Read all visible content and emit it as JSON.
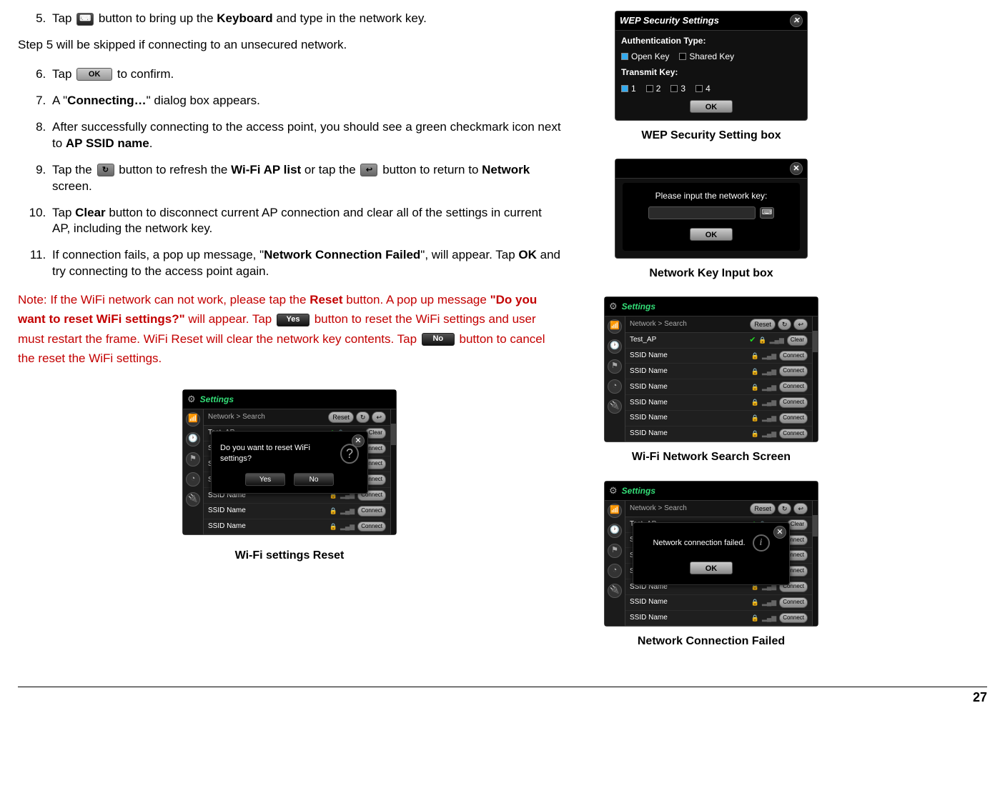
{
  "pageNumber": "27",
  "instructions": {
    "start": 5,
    "step5": {
      "prefix": "Tap ",
      "afterIcon": " button to bring up the ",
      "bold1": "Keyboard",
      "suffix": " and type in the network key."
    },
    "skipLine": "Step 5 will be skipped if connecting to an unsecured network.",
    "step6": {
      "prefix": "Tap ",
      "okLabel": "OK",
      "suffix": " to confirm."
    },
    "step7": {
      "prefix": "A \"",
      "bold": "Connecting…",
      "suffix": "\" dialog box appears."
    },
    "step8": {
      "line1": "After successfully connecting to the access point, you should see a green checkmark icon next to ",
      "bold": "AP SSID name",
      "suffix": "."
    },
    "step9": {
      "prefix": "Tap the ",
      "mid1": " button to refresh the ",
      "bold1": "Wi-Fi AP list",
      "mid2": " or tap the ",
      "mid3": " button to return to ",
      "bold2": "Network",
      "suffix": " screen."
    },
    "step10": {
      "prefix": "Tap ",
      "bold": "Clear",
      "suffix": " button to disconnect current AP connection and clear all of the settings in current AP, including the network key."
    },
    "step11": {
      "p1": "If connection fails, a pop up message, \"",
      "bold1": "Network Connection Failed",
      "p2": "\", will appear.  Tap ",
      "bold2": "OK",
      "p3": " and try connecting to the access point again."
    }
  },
  "note": {
    "p1": "Note: If the WiFi network can not work, please tap the ",
    "b1": "Reset",
    "p2": " button. A pop up message ",
    "b2": "\"Do you want to reset WiFi settings?\"",
    "p3": " will appear. Tap ",
    "yes": "Yes",
    "p4": " button to reset the WiFi settings and user must restart the frame. WiFi Reset will clear the network key contents. Tap ",
    "no": "No",
    "p5": " button to cancel the reset the WiFi settings."
  },
  "figures": {
    "wepCaption": "WEP Security Setting box",
    "keyCaption": "Network Key Input box",
    "searchCaption": "Wi-Fi Network Search Screen",
    "failCaption": "Network Connection Failed",
    "resetCaption": "Wi-Fi settings Reset"
  },
  "wep": {
    "title": "WEP Security Settings",
    "authLabel": "Authentication Type:",
    "openKey": "Open Key",
    "sharedKey": "Shared Key",
    "transmitLabel": "Transmit Key:",
    "k1": "1",
    "k2": "2",
    "k3": "3",
    "k4": "4",
    "ok": "OK"
  },
  "keyInput": {
    "prompt": "Please input the network key:",
    "ok": "OK"
  },
  "settingsScreen": {
    "title": "Settings",
    "breadcrumb": "Network > Search",
    "reset": "Reset",
    "items": [
      {
        "name": "Test_AP",
        "btn": "Clear",
        "connected": true
      },
      {
        "name": "SSID Name",
        "btn": "Connect",
        "connected": false
      },
      {
        "name": "SSID Name",
        "btn": "Connect",
        "connected": false
      },
      {
        "name": "SSID Name",
        "btn": "Connect",
        "connected": false
      },
      {
        "name": "SSID Name",
        "btn": "Connect",
        "connected": false
      },
      {
        "name": "SSID Name",
        "btn": "Connect",
        "connected": false
      },
      {
        "name": "SSID Name",
        "btn": "Connect",
        "connected": false
      }
    ]
  },
  "failDialog": {
    "msg": "Network  connection  failed.",
    "ok": "OK"
  },
  "resetDialog": {
    "msg": "Do you want to reset WiFi settings?",
    "yes": "Yes",
    "no": "No"
  }
}
